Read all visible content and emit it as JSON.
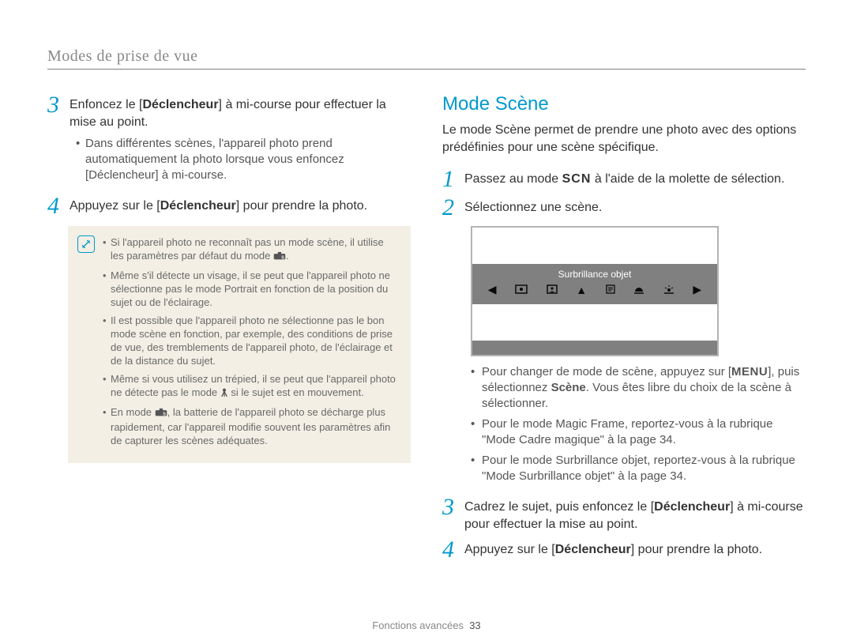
{
  "header": "Modes de prise de vue",
  "left": {
    "step3": {
      "num": "3",
      "text_before": "Enfoncez le [",
      "de": "Déclencheur",
      "text_after": "] à mi-course pour effectuer la mise au point."
    },
    "step3_sub": {
      "text_1": "Dans différentes scènes, l'appareil photo prend automatiquement la photo lorsque vous enfoncez [",
      "de": "Déclencheur",
      "text_2": "] à mi-course."
    },
    "step4": {
      "num": "4",
      "before": "Appuyez sur le [",
      "de": "Déclencheur",
      "after": "] pour prendre la photo."
    },
    "notes": [
      "Si l'appareil photo ne reconnaît pas un mode scène, il utilise les paramètres par défaut du mode ",
      "Même s'il détecte un visage, il se peut que l'appareil photo ne sélectionne pas le mode Portrait en fonction de la position du sujet ou de l'éclairage.",
      "Il est possible que l'appareil photo ne sélectionne pas le bon mode scène en fonction, par exemple, des conditions de prise de vue, des tremblements de l'appareil photo, de l'éclairage et de la distance du sujet.",
      "Même si vous utilisez un trépied, il se peut que l'appareil photo ne détecte pas le mode ",
      "En mode "
    ],
    "note0_tail": ".",
    "note3_tail": " si le sujet est en mouvement.",
    "note4_tail": ", la batterie de l'appareil photo se décharge plus rapidement, car l'appareil modifie souvent les paramètres afin de capturer les scènes adéquates."
  },
  "right": {
    "heading": "Mode Scène",
    "lead": "Le mode Scène permet de prendre une photo avec des options prédéfinies pour une scène spécifique.",
    "step1": {
      "num": "1",
      "before": "Passez au mode ",
      "scn": "SCN",
      "after": " à l'aide de la molette de sélection."
    },
    "step2": {
      "num": "2",
      "text": "Sélectionnez une scène."
    },
    "lcd_label": "Surbrillance objet",
    "lcd_icons": [
      "arrow-left-icon",
      "frame-icon",
      "portrait-icon",
      "landscape-icon",
      "text-icon",
      "sunset-icon",
      "dawn-icon",
      "arrow-right-icon"
    ],
    "bullets": [
      {
        "b1": "Pour changer de mode de scène, appuyez sur [",
        "menu": "MENU",
        "b2": "], puis sélectionnez ",
        "scene": "Scène",
        "b3": ". Vous êtes libre du choix de la scène à sélectionner."
      },
      {
        "text": "Pour le mode Magic Frame, reportez-vous à la rubrique \"Mode Cadre magique\" à la page 34."
      },
      {
        "text": "Pour le mode Surbrillance objet, reportez-vous à la rubrique \"Mode Surbrillance objet\" à la page 34."
      }
    ],
    "step3": {
      "num": "3",
      "before": "Cadrez le sujet, puis enfoncez le [",
      "de": "Déclencheur",
      "after": "] à mi-course pour effectuer la mise au point."
    },
    "step4": {
      "num": "4",
      "before": "Appuyez sur le [",
      "de": "Déclencheur",
      "after": "] pour prendre la photo."
    }
  },
  "footer": {
    "section": "Fonctions avancées",
    "page": "33"
  }
}
